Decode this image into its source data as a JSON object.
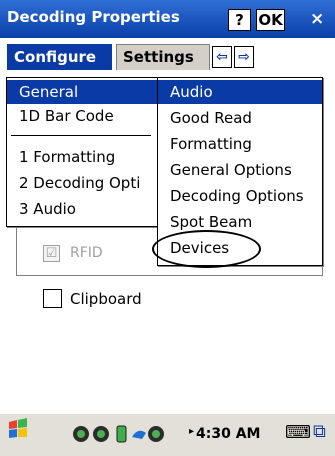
{
  "window": {
    "title": "Decoding Properties",
    "help_label": "?",
    "ok_label": "OK",
    "close_label": "×"
  },
  "tabs": {
    "configure": "Configure",
    "settings": "Settings",
    "prev_arrow": "⇦",
    "next_arrow": "⇨"
  },
  "content": {
    "rfid_label": "RFID",
    "rfid_checked": true,
    "rfid_check_mark": "☑",
    "clipboard_label": "Clipboard",
    "clipboard_checked": false
  },
  "menu1": {
    "items": [
      {
        "label": "General",
        "selected": true
      },
      {
        "label": "1D Bar Code",
        "selected": false
      },
      {
        "label": "1 Formatting",
        "selected": false
      },
      {
        "label": "2 Decoding Opti",
        "selected": false
      },
      {
        "label": "3 Audio",
        "selected": false
      }
    ]
  },
  "menu2": {
    "items": [
      {
        "label": "Audio",
        "selected": true
      },
      {
        "label": "Good Read",
        "selected": false
      },
      {
        "label": "Formatting",
        "selected": false
      },
      {
        "label": "General Options",
        "selected": false
      },
      {
        "label": "Decoding Options",
        "selected": false
      },
      {
        "label": "Spot Beam",
        "selected": false
      },
      {
        "label": "Devices",
        "selected": false
      }
    ]
  },
  "taskbar": {
    "start_icon": "windows-flag-icon",
    "clock": "4:30 AM",
    "tray_arrow": "▸",
    "keyboard_icon": "⌨",
    "network_icon": "⧉"
  },
  "colors": {
    "accent": "#0a3aa6",
    "title_bar": "#1b56c4"
  }
}
